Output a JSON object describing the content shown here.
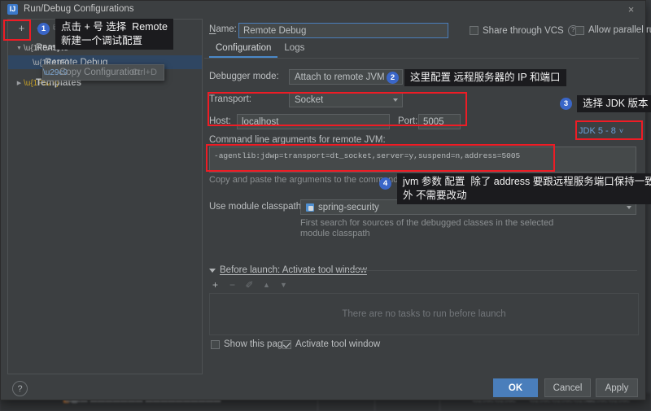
{
  "window": {
    "title": "Run/Debug Configurations",
    "app_icon": "intellij-idea-icon",
    "close_label": "×"
  },
  "tree_toolbar": {
    "add_label": "+",
    "remove_label": "−",
    "copy_label": "⧉",
    "save_label": "↓",
    "up_label": "▲",
    "down_label": "▼",
    "sort_label": "⇅"
  },
  "tree": {
    "items": [
      {
        "label": "Remote",
        "icon": "remote-config-icon",
        "arrow": "▼",
        "bold": false
      },
      {
        "label": "Remote Debug",
        "icon": "remote-debug-icon",
        "arrow": "",
        "bold": false
      },
      {
        "label": "Templates",
        "icon": "wrench-icon",
        "arrow": "▶",
        "bold": true
      }
    ]
  },
  "context_menu": {
    "icon": "copy-icon",
    "label": "Copy Configuration",
    "shortcut": "Ctrl+D"
  },
  "config": {
    "name_label": "Name:",
    "name_value": "Remote Debug",
    "share_vcs_label": "Share through VCS",
    "share_vcs_checked": false,
    "share_help": "?",
    "allow_parallel_label": "Allow parallel run",
    "allow_parallel_checked": false,
    "tabs": [
      {
        "label": "Configuration",
        "active": true
      },
      {
        "label": "Logs",
        "active": false
      }
    ],
    "debugger_mode_label": "Debugger mode:",
    "debugger_mode_value": "Attach to remote JVM",
    "transport_label": "Transport:",
    "transport_value": "Socket",
    "host_label": "Host:",
    "host_value": "localhost",
    "port_label": "Port:",
    "port_value": "5005",
    "cmdline_label": "Command line arguments for remote JVM:",
    "cmdline_value": "-agentlib:jdwp=transport=dt_socket,server=y,suspend=n,address=5005",
    "cmdline_hint": "Copy and paste the arguments to the command line when JVM is started",
    "jdk_selector": "JDK 5 - 8",
    "jdk_chevron": "˅",
    "module_classpath_label": "Use module classpath:",
    "module_classpath_value": "spring-security",
    "module_classpath_hint_line1": "First search for sources of the debugged classes in the selected",
    "module_classpath_hint_line2": "module classpath",
    "before_launch_label": "Before launch: Activate tool window",
    "before_launch_toolbar": {
      "add": "+",
      "remove": "−",
      "edit": "✐",
      "up": "▲",
      "down": "▼"
    },
    "before_launch_empty": "There are no tasks to run before launch",
    "show_page_label": "Show this page",
    "show_page_checked": false,
    "activate_tool_window_label": "Activate tool window",
    "activate_tool_window_checked": true
  },
  "footer": {
    "help_label": "?",
    "ok_label": "OK",
    "cancel_label": "Cancel",
    "apply_label": "Apply"
  },
  "annotations": {
    "accent_color": "#ee1c25",
    "badge_color": "#3a66c8",
    "items": [
      {
        "number": "1",
        "text": "点击 + 号 选择  Remote\n新建一个调试配置"
      },
      {
        "number": "2",
        "text": "这里配置 远程服务器的 IP 和端口"
      },
      {
        "number": "3",
        "text": "选择 JDK 版本"
      },
      {
        "number": "4",
        "text": "jvm 参数 配置  除了 address 要跟远程服务端口保持一致\n外 不需要改动"
      }
    ]
  },
  "background": {
    "left_glyphs": "g\ng\n|\n.",
    "bottom_text": "▬▬▬ ▬▬▬▬▬▬▬ ▬▬▬▬▬▬▬▬▬▬"
  }
}
